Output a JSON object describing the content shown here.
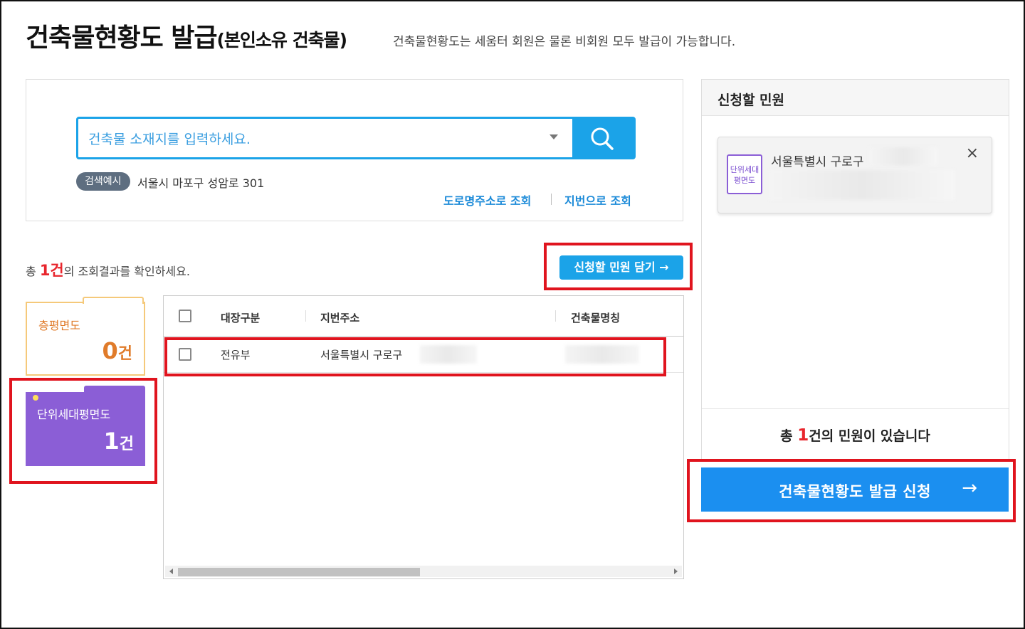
{
  "header": {
    "title_main": "건축물현황도 발급",
    "title_sub": "(본인소유 건축물)",
    "description": "건축물현황도는 세움터 회원은 물론 비회원 모두 발급이 가능합니다."
  },
  "search": {
    "placeholder": "건축물 소재지를 입력하세요.",
    "example_badge": "검색예시",
    "example_text": "서울시 마포구 성암로 301",
    "link_road": "도로명주소로 조회",
    "link_lot": "지번으로 조회"
  },
  "results": {
    "prefix": "총 ",
    "count": "1건",
    "suffix": "의 조회결과를 확인하세요.",
    "add_button": "신청할 민원 담기 →"
  },
  "categories": [
    {
      "label": "층평면도",
      "count": "0",
      "unit": "건"
    },
    {
      "label": "단위세대평면도",
      "count": "1",
      "unit": "건"
    }
  ],
  "table": {
    "headers": [
      "대장구분",
      "지번주소",
      "건축물명칭"
    ],
    "rows": [
      {
        "type": "전유부",
        "address": "서울특별시 구로구"
      }
    ]
  },
  "cart": {
    "title": "신청할 민원",
    "item": {
      "icon_line1": "단위세대",
      "icon_line2": "평면도",
      "address": "서울특별시 구로구",
      "close": "×"
    },
    "total_prefix": "총 ",
    "total_count": "1",
    "total_suffix": "건의 민원이 있습니다"
  },
  "apply": {
    "label": "건축물현황도 발급 신청",
    "arrow": "→"
  },
  "colors": {
    "accent": "#1ba3e8",
    "apply_button": "#1b8ff0",
    "highlight": "#e0141e",
    "floor_plan": "#e07b2a",
    "unit_plan": "#8b5ed6"
  }
}
